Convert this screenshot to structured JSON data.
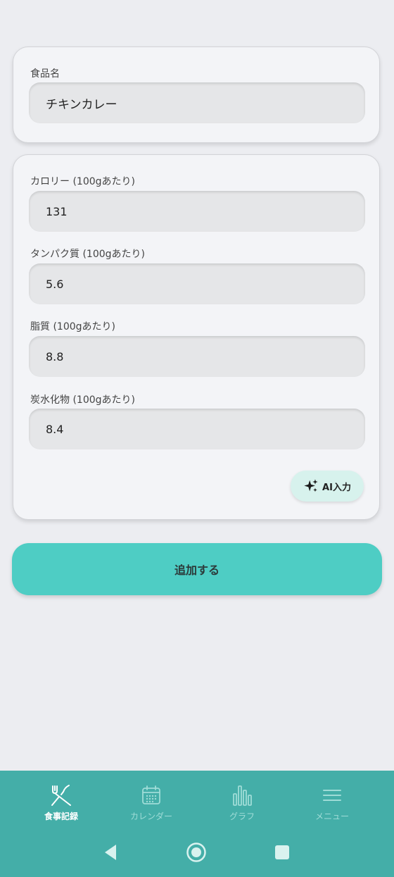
{
  "food_card": {
    "name_label": "食品名",
    "name_value": "チキンカレー"
  },
  "nutrition_card": {
    "calorie_label": "カロリー (100gあたり)",
    "calorie_value": "131",
    "protein_label": "タンパク質 (100gあたり)",
    "protein_value": "5.6",
    "fat_label": "脂質 (100gあたり)",
    "fat_value": "8.8",
    "carb_label": "炭水化物 (100gあたり)",
    "carb_value": "8.4",
    "ai_button_label": "AI入力"
  },
  "add_button_label": "追加する",
  "bottom_nav": {
    "items": [
      {
        "label": "食事記録",
        "icon": "fork-knife-icon",
        "active": true
      },
      {
        "label": "カレンダー",
        "icon": "calendar-icon",
        "active": false
      },
      {
        "label": "グラフ",
        "icon": "bar-chart-icon",
        "active": false
      },
      {
        "label": "メニュー",
        "icon": "menu-icon",
        "active": false
      }
    ]
  },
  "colors": {
    "accent": "#4ecdc4",
    "nav_background": "#44aea8",
    "page_background": "#ecedf1"
  }
}
